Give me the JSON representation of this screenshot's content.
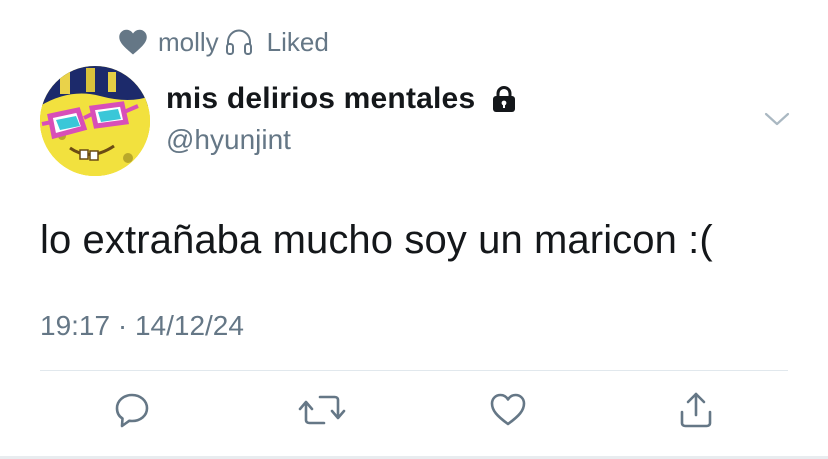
{
  "social_context": {
    "user": "molly",
    "action": "Liked",
    "icons": [
      "heart-icon",
      "headphones-icon"
    ]
  },
  "tweet": {
    "display_name": "mis delirios mentales",
    "handle": "@hyunjint",
    "protected_icon": "lock-icon",
    "text": "lo extrañaba mucho soy un maricon :(",
    "timestamp": "19:17 · 14/12/24"
  },
  "actions": [
    {
      "name": "reply",
      "icon": "reply-icon"
    },
    {
      "name": "retweet",
      "icon": "retweet-icon"
    },
    {
      "name": "like",
      "icon": "like-icon"
    },
    {
      "name": "share",
      "icon": "share-icon"
    }
  ],
  "colors": {
    "text_primary": "#14171a",
    "text_secondary": "#657786",
    "icon_gray": "#657786",
    "divider": "#e1e8ed"
  }
}
